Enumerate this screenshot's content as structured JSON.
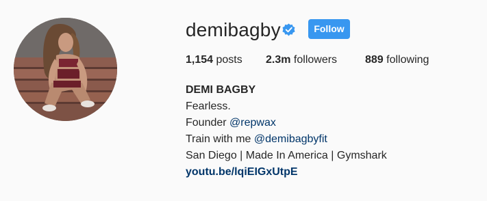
{
  "profile": {
    "username": "demibagby",
    "follow_label": "Follow",
    "stats": [
      {
        "value": "1,154",
        "label": "posts"
      },
      {
        "value": "2.3m",
        "label": "followers"
      },
      {
        "value": "889",
        "label": "following"
      }
    ],
    "bio": {
      "full_name": "DEMI BAGBY",
      "line1": "Fearless.",
      "line2_prefix": "Founder",
      "line2_mention": "@repwax",
      "line3_prefix": "Train with me",
      "line3_mention": "@demibagbyfit",
      "line4": "San Diego | Made In America | Gymshark",
      "website": "youtu.be/lqiEIGxUtpE"
    }
  },
  "colors": {
    "follow_button": "#3897f0",
    "verified_badge": "#3897f0",
    "link": "#003569",
    "background": "#fafafa",
    "text": "#262626"
  },
  "icons": {
    "verified": "verified-badge-icon"
  }
}
